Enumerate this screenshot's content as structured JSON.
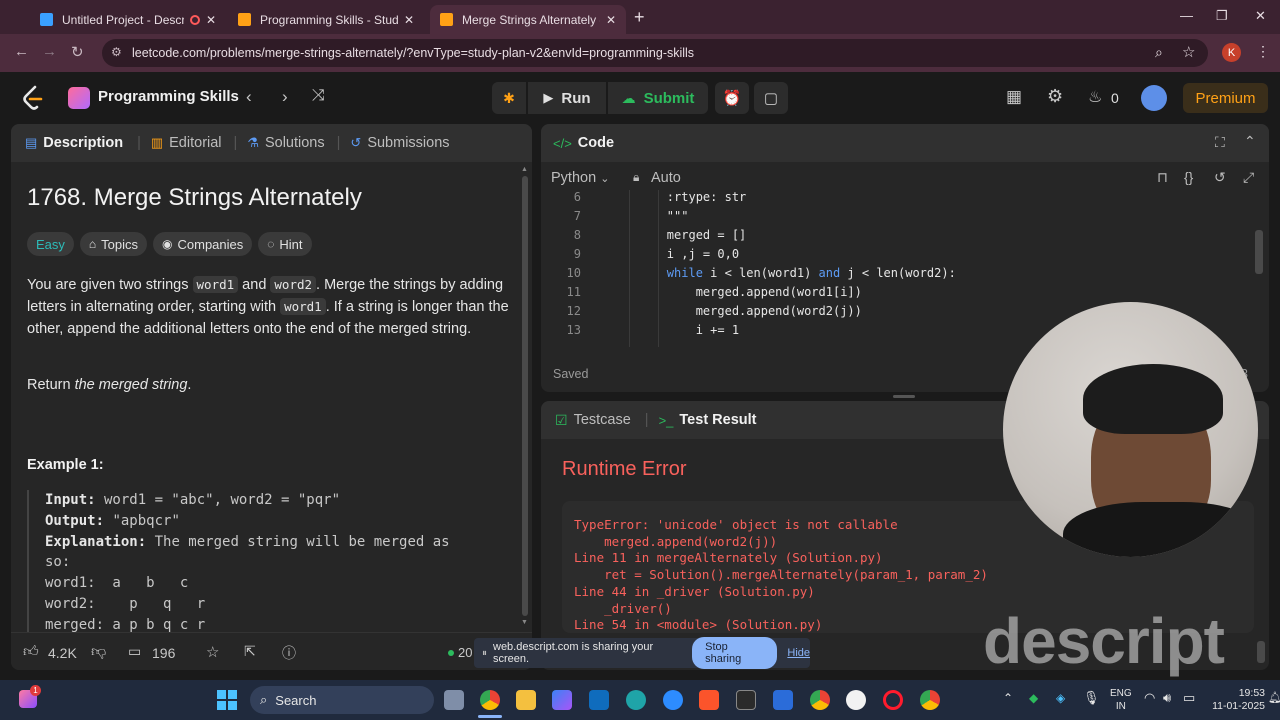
{
  "browser": {
    "tabs": [
      {
        "title": "Untitled Project - Descript",
        "active": false
      },
      {
        "title": "Programming Skills - Study Plan",
        "active": false
      },
      {
        "title": "Merge Strings Alternately - Lee",
        "active": true
      }
    ],
    "new_tab": "+",
    "url": "leetcode.com/problems/merge-strings-alternately/?envType=study-plan-v2&envId=programming-skills",
    "profile_initial": "K"
  },
  "topbar": {
    "study_plan": "Programming Skills",
    "run_label": "Run",
    "submit_label": "Submit",
    "streak_count": "0",
    "premium_label": "Premium"
  },
  "left_panel": {
    "tabs": {
      "description": "Description",
      "editorial": "Editorial",
      "solutions": "Solutions",
      "submissions": "Submissions"
    },
    "title": "1768. Merge Strings Alternately",
    "chips": {
      "difficulty": "Easy",
      "topics": "Topics",
      "companies": "Companies",
      "hint": "Hint"
    },
    "para1": {
      "t1": "You are given two strings ",
      "c1": "word1",
      "t2": " and ",
      "c2": "word2",
      "t3": ". Merge the strings by adding letters in alternating order, starting with ",
      "c3": "word1",
      "t4": ". If a string is longer than the other, append the additional letters onto the end of the merged string."
    },
    "para2": {
      "t1": "Return ",
      "em": "the merged string",
      "t2": "."
    },
    "example_title": "Example 1:",
    "example": {
      "input_label": "Input:",
      "input_value": " word1 = \"abc\", word2 = \"pqr\"",
      "output_label": "Output:",
      "output_value": " \"apbqcr\"",
      "explanation_label": "Explanation:",
      "explanation_value": " The merged string will be merged as",
      "line_so": "so:",
      "line_w1": "word1:  a   b   c",
      "line_w2": "word2:    p   q   r",
      "line_merged": "merged: a p b q c r"
    },
    "footer": {
      "likes": "4.2K",
      "comments": "196",
      "online": "20"
    }
  },
  "code_panel": {
    "title": "Code",
    "language": "Python",
    "auto_label": "Auto",
    "status": "Saved",
    "status_right": "3",
    "lines": [
      {
        "num": "6",
        "text": "        :rtype: str"
      },
      {
        "num": "7",
        "text": "        \"\"\""
      },
      {
        "num": "8",
        "text": "        merged = []"
      },
      {
        "num": "9",
        "text": "        i ,j = 0,0"
      },
      {
        "num": "10",
        "pre": "        ",
        "kw1": "while",
        "mid": " i < len(word1) ",
        "kw2": "and",
        "post": " j < len(word2):"
      },
      {
        "num": "11",
        "text": "            merged.append(word1[i])"
      },
      {
        "num": "12",
        "text": "            merged.append(word2(j))"
      },
      {
        "num": "13",
        "text": "            i += 1"
      }
    ]
  },
  "result_panel": {
    "tab_testcase": "Testcase",
    "tab_result": "Test Result",
    "heading": "Runtime Error",
    "error_lines": [
      "TypeError: 'unicode' object is not callable",
      "    merged.append(word2(j))",
      "Line 11 in mergeAlternately (Solution.py)",
      "    ret = Solution().mergeAlternately(param_1, param_2)",
      "Line 44 in _driver (Solution.py)",
      "    _driver()",
      "Line 54 in <module> (Solution.py)"
    ]
  },
  "share_bar": {
    "text": "web.descript.com is sharing your screen.",
    "stop_label": "Stop sharing",
    "hide_label": "Hide"
  },
  "watermark": "descript",
  "taskbar": {
    "search_label": "Search",
    "lang_top": "ENG",
    "lang_bottom": "IN",
    "time": "19:53",
    "date": "11-01-2025",
    "notification_badge": "1"
  },
  "colors": {
    "accent_green": "#2cbb5d",
    "error_red": "#f8615c",
    "premium": "#ffa116",
    "link_blue": "#5d9bf4"
  }
}
